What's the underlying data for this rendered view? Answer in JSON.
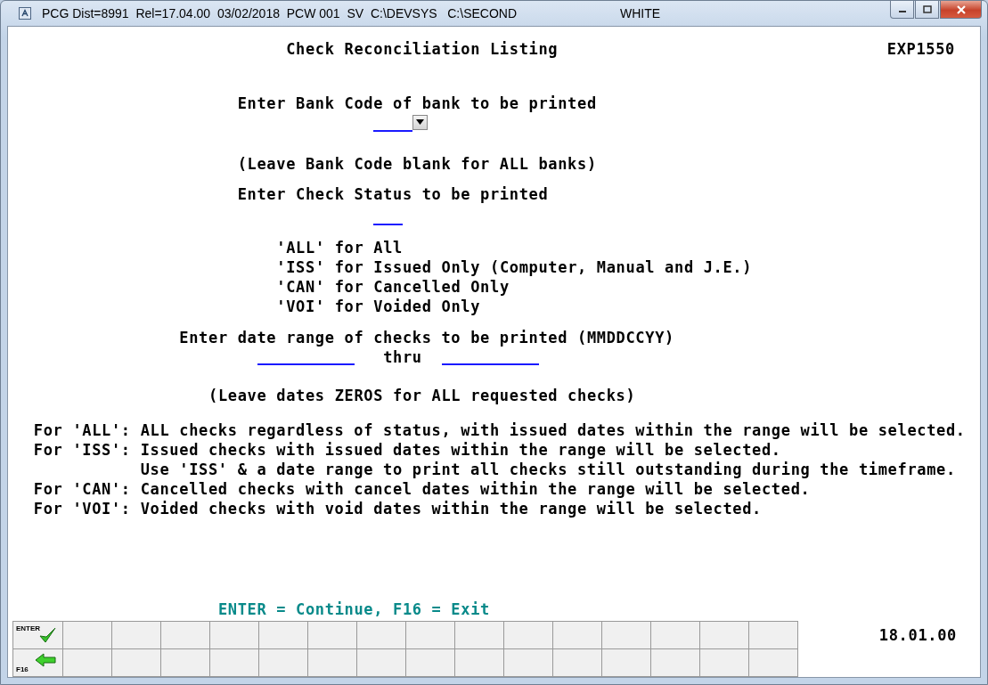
{
  "window": {
    "title": "PCG Dist=8991  Rel=17.04.00  03/02/2018  PCW 001  SV  C:\\DEVSYS   C:\\SECOND",
    "user": "WHITE"
  },
  "screen": {
    "title": "Check Reconciliation Listing",
    "program_id": "EXP1550"
  },
  "bank_code": {
    "prompt": "Enter Bank Code of bank to be printed",
    "hint": "(Leave Bank Code blank for ALL banks)"
  },
  "check_status": {
    "prompt": "Enter Check Status to be printed",
    "options": [
      "'ALL' for All",
      "'ISS' for Issued Only (Computer, Manual and J.E.)",
      "'CAN' for Cancelled Only",
      "'VOI' for Voided Only"
    ]
  },
  "date_range": {
    "prompt": "Enter date range of checks to be printed (MMDDCCYY)",
    "separator": "thru",
    "hint": "(Leave dates ZEROS for ALL requested checks)"
  },
  "notes": [
    {
      "label": "For 'ALL':",
      "text": "ALL checks regardless of status, with issued dates within the range will be selected."
    },
    {
      "label": "For 'ISS':",
      "text": "Issued checks with issued dates within the range will be selected."
    },
    {
      "text": "Use 'ISS' & a date range to print all checks still outstanding during the timeframe."
    },
    {
      "label": "For 'CAN':",
      "text": "Cancelled checks with cancel dates within the range will be selected."
    },
    {
      "label": "For 'VOI':",
      "text": "Voided checks with void dates within the range will be selected."
    }
  ],
  "footer": {
    "prompt": "ENTER = Continue, F16 = Exit",
    "version": "18.01.00"
  },
  "function_keys": [
    {
      "kind": "enter",
      "label": "ENTER"
    },
    {
      "kind": "exit",
      "label": "F16"
    }
  ]
}
